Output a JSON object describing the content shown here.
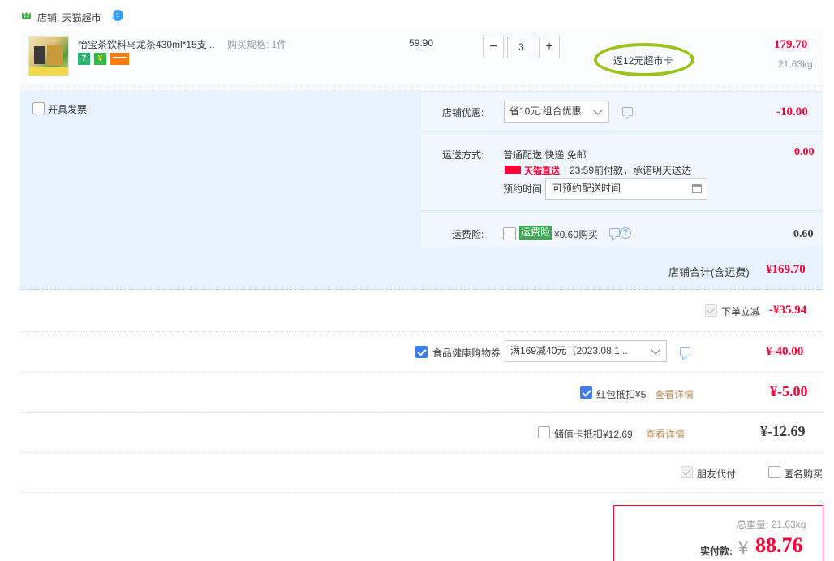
{
  "shop": {
    "label": "店铺: 天猫超市",
    "icon": "tmall-shop-icon",
    "chat_icon": "wangwang-chat-icon"
  },
  "item": {
    "title": "怡宝茶饮料乌龙茶430ml*15支...",
    "spec": "购买规格: 1件",
    "unit_price": "59.90",
    "quantity": "3",
    "qty_minus": "−",
    "qty_plus": "+",
    "rebate": "返12元超市卡",
    "total": "179.70",
    "weight": "21.63kg",
    "badges": [
      "7",
      "¥",
      ""
    ]
  },
  "invoice": {
    "label": "开具发票"
  },
  "shop_discount": {
    "label": "店铺优惠:",
    "selected": "省10元:组合优惠",
    "value": "-10.00"
  },
  "shipping": {
    "label": "运送方式:",
    "method": "普通配送 快递 免邮",
    "tmall_label": "天猫直送",
    "promise": "23:59前付款，承诺明天送达",
    "appointment_label": "预约时间",
    "appointment_value": "可预约配送时间",
    "value": "0.00"
  },
  "insurance": {
    "label": "运费险:",
    "tag": "运费险",
    "price": "¥0.60购买",
    "value": "0.60"
  },
  "subtotal": {
    "label": "店铺合计(含运费)",
    "value": "¥169.70"
  },
  "instant_discount": {
    "label": "下单立减",
    "value": "-¥35.94"
  },
  "food_coupon": {
    "label": "食品健康购物券",
    "selected": "满169减40元（2023.08.1...",
    "value": "¥-40.00"
  },
  "red_packet": {
    "label": "红包抵扣¥5",
    "link": "查看详情",
    "value": "¥-5.00"
  },
  "stored_card": {
    "label": "储值卡抵扣¥12.69",
    "link": "查看详情",
    "value": "¥-12.69"
  },
  "extras": {
    "friend_pay": "朋友代付",
    "anonymous": "匿名购买"
  },
  "summary": {
    "weight": "总重量: 21.63kg",
    "pay_label": "实付款:",
    "currency": "¥",
    "amount": "88.76"
  },
  "colors": {
    "price_red": "#ff0036",
    "panel_blue": "#e8f2ff",
    "highlight_green": "#9bc31c",
    "link_brown": "#b88e5a"
  }
}
